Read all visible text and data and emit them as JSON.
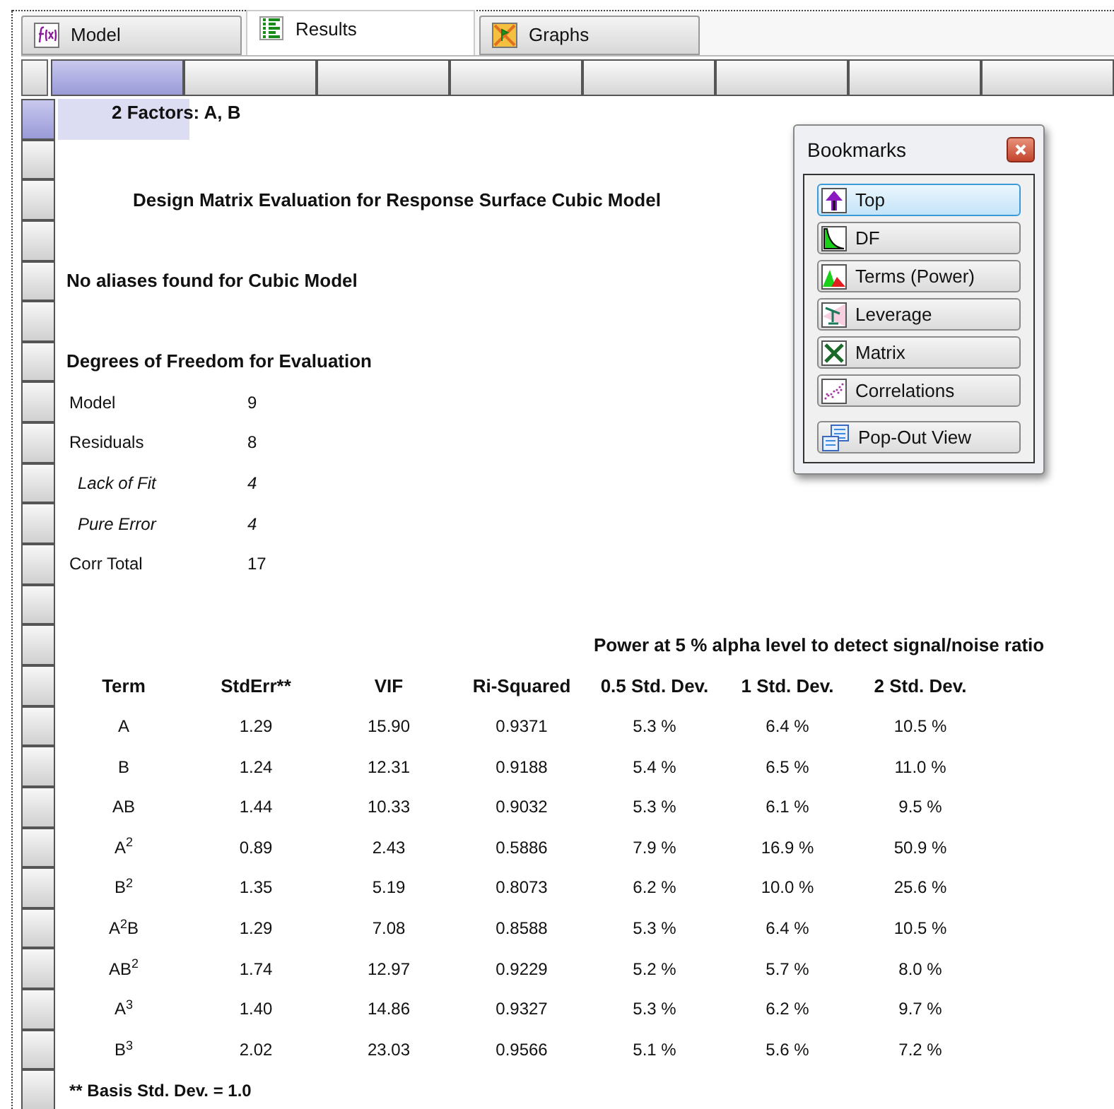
{
  "tabs": [
    {
      "label": "Model",
      "kind": "model",
      "selected": false
    },
    {
      "label": "Results",
      "kind": "results",
      "selected": true
    },
    {
      "label": "Graphs",
      "kind": "graphs",
      "selected": false
    }
  ],
  "column_headers": [
    {
      "selected": true
    },
    {
      "selected": false
    },
    {
      "selected": false
    },
    {
      "selected": false
    },
    {
      "selected": false
    },
    {
      "selected": false
    },
    {
      "selected": false
    },
    {
      "selected": false
    }
  ],
  "rows": [
    {
      "kind": "caption",
      "text": "2 Factors: A, B",
      "selected": true
    },
    {
      "kind": "blank",
      "selected": false
    },
    {
      "kind": "title",
      "text": "Design Matrix Evaluation for Response Surface Cubic Model",
      "selected": false
    },
    {
      "kind": "blank",
      "selected": false
    },
    {
      "kind": "heading",
      "text": "No aliases found for Cubic Model",
      "selected": false
    },
    {
      "kind": "blank",
      "selected": false
    },
    {
      "kind": "heading",
      "text": "Degrees of Freedom for Evaluation",
      "selected": false
    },
    {
      "kind": "df",
      "label": "Model",
      "value": "9",
      "sub": false,
      "selected": false
    },
    {
      "kind": "df",
      "label": "Residuals",
      "value": "8",
      "sub": false,
      "selected": false
    },
    {
      "kind": "df",
      "label": "Lack of Fit",
      "value": "4",
      "sub": true,
      "selected": false
    },
    {
      "kind": "df",
      "label": "Pure Error",
      "value": "4",
      "sub": true,
      "selected": false
    },
    {
      "kind": "df",
      "label": "Corr Total",
      "value": "17",
      "sub": false,
      "selected": false
    },
    {
      "kind": "blank",
      "selected": false
    },
    {
      "kind": "note",
      "text": "Power at 5 % alpha level to detect signal/noise ratio",
      "selected": false
    },
    {
      "kind": "table_header",
      "cells": [
        "Term",
        "StdErr**",
        "VIF",
        "Ri-Squared",
        "0.5 Std. Dev.",
        "1 Std. Dev.",
        "2 Std. Dev."
      ],
      "selected": false
    },
    {
      "kind": "table_row",
      "cells": [
        "A",
        "1.29",
        "15.90",
        "0.9371",
        "5.3 %",
        "6.4 %",
        "10.5 %"
      ],
      "selected": false
    },
    {
      "kind": "table_row",
      "cells": [
        "B",
        "1.24",
        "12.31",
        "0.9188",
        "5.4 %",
        "6.5 %",
        "11.0 %"
      ],
      "selected": false
    },
    {
      "kind": "table_row",
      "cells": [
        "AB",
        "1.44",
        "10.33",
        "0.9032",
        "5.3 %",
        "6.1 %",
        "9.5 %"
      ],
      "selected": false
    },
    {
      "kind": "table_row",
      "cells": [
        "A$^{2}$",
        "0.89",
        "2.43",
        "0.5886",
        "7.9 %",
        "16.9 %",
        "50.9 %"
      ],
      "selected": false
    },
    {
      "kind": "table_row",
      "cells": [
        "B$^{2}$",
        "1.35",
        "5.19",
        "0.8073",
        "6.2 %",
        "10.0 %",
        "25.6 %"
      ],
      "selected": false
    },
    {
      "kind": "table_row",
      "cells": [
        "A$^{2}$B",
        "1.29",
        "7.08",
        "0.8588",
        "5.3 %",
        "6.4 %",
        "10.5 %"
      ],
      "selected": false
    },
    {
      "kind": "table_row",
      "cells": [
        "AB$^{2}$",
        "1.74",
        "12.97",
        "0.9229",
        "5.2 %",
        "5.7 %",
        "8.0 %"
      ],
      "selected": false
    },
    {
      "kind": "table_row",
      "cells": [
        "A$^{3}$",
        "1.40",
        "14.86",
        "0.9327",
        "5.3 %",
        "6.2 %",
        "9.7 %"
      ],
      "selected": false
    },
    {
      "kind": "table_row",
      "cells": [
        "B$^{3}$",
        "2.02",
        "23.03",
        "0.9566",
        "5.1 %",
        "5.6 %",
        "7.2 %"
      ],
      "selected": false
    },
    {
      "kind": "footnote",
      "text": "** Basis Std. Dev. = 1.0",
      "selected": false
    }
  ],
  "bookmarks": {
    "title": "Bookmarks",
    "items": [
      {
        "label": "Top",
        "kind": "top",
        "selected": true
      },
      {
        "label": "DF",
        "kind": "df",
        "selected": false
      },
      {
        "label": "Terms (Power)",
        "kind": "terms",
        "selected": false
      },
      {
        "label": "Leverage",
        "kind": "leverage",
        "selected": false
      },
      {
        "label": "Matrix",
        "kind": "matrix",
        "selected": false
      },
      {
        "label": "Correlations",
        "kind": "correlations",
        "selected": false
      },
      {
        "label": "Pop-Out View",
        "kind": "popout",
        "selected": false
      }
    ]
  }
}
